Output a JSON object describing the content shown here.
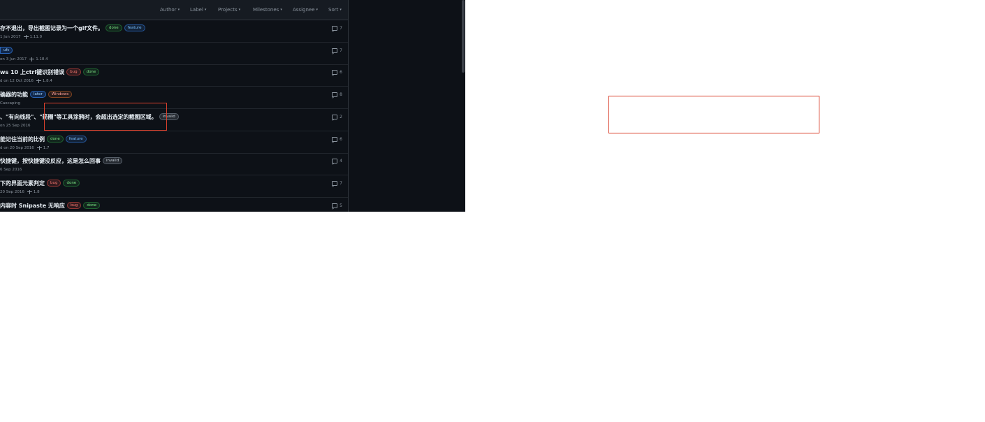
{
  "filters": [
    {
      "label": "Author"
    },
    {
      "label": "Label"
    },
    {
      "label": "Projects"
    },
    {
      "label": "Milestones"
    },
    {
      "label": "Assignee"
    },
    {
      "label": "Sort"
    }
  ],
  "issues": [
    {
      "title": "存不退出，导出截图记录为一个gif文件。",
      "meta": "1 Jun 2017",
      "milestone": "1.11.0",
      "comments": "7",
      "labels": [
        {
          "text": "done",
          "kind": "done"
        },
        {
          "text": "feature",
          "kind": "feature"
        }
      ]
    },
    {
      "title": "",
      "meta": "on 3 Jun 2017",
      "milestone": "1.18.4",
      "comments": "7",
      "labels": [
        {
          "text": "ufc",
          "kind": "ufc"
        }
      ]
    },
    {
      "title": "ws 10 上ctrl键识别错误",
      "meta": "d on 12 Oct 2016",
      "milestone": "1.8.4",
      "comments": "6",
      "labels": [
        {
          "text": "bug",
          "kind": "bug"
        },
        {
          "text": "done",
          "kind": "done"
        }
      ]
    },
    {
      "title": "确器的功能",
      "meta": "Caocaping",
      "milestone": "",
      "comments": "8",
      "labels": [
        {
          "text": "later",
          "kind": "later"
        },
        {
          "text": "Windows",
          "kind": "windows"
        }
      ]
    },
    {
      "title": "、\"有向线段\"、\"箭圈\"等工具涂鸦时，会超出选定的截图区域。",
      "meta": "on 25 Sep 2016",
      "milestone": "",
      "comments": "2",
      "labels": [
        {
          "text": "invalid",
          "kind": "invalid"
        }
      ]
    },
    {
      "title": "能记住当前的比例",
      "meta": "d on 20 Sep 2016",
      "milestone": "1.7",
      "comments": "6",
      "labels": [
        {
          "text": "done",
          "kind": "done"
        },
        {
          "text": "feature",
          "kind": "feature"
        }
      ]
    },
    {
      "title": "快捷键，按快捷键没反应，这是怎么回事",
      "meta": "6 Sep 2016",
      "milestone": "",
      "comments": "4",
      "labels": [
        {
          "text": "invalid",
          "kind": "invalid"
        }
      ]
    },
    {
      "title": "下的界面元素判定",
      "meta": "20 Sep 2016",
      "milestone": "1.8",
      "comments": "7",
      "labels": [
        {
          "text": "bug",
          "kind": "bug"
        },
        {
          "text": "done",
          "kind": "done"
        }
      ]
    },
    {
      "title": "内容时 Snipaste 无响应",
      "meta": "",
      "milestone": "",
      "comments": "5",
      "labels": [
        {
          "text": "bug",
          "kind": "bug"
        },
        {
          "text": "done",
          "kind": "done"
        }
      ]
    }
  ]
}
